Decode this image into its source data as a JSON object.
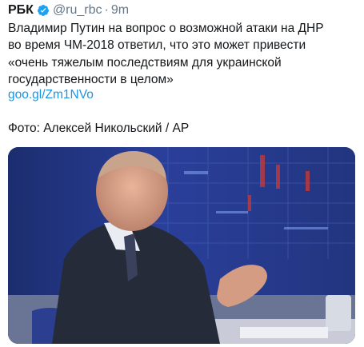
{
  "tweet": {
    "author_name": "РБК",
    "handle": "@ru_rbc",
    "separator": "·",
    "timestamp": "9m",
    "text_lines": [
      "Владимир Путин на вопрос о возможной атаки на ДНР",
      "во время ЧМ-2018 ответил, что это может привести",
      "«очень тяжелым последствиям для украинской",
      "государственности в целом»"
    ],
    "link": "goo.gl/Zm1NVo",
    "photo_credit": "Фото: Алексей Никольский / AP"
  },
  "icons": {
    "verified": "verified-badge-icon"
  },
  "colors": {
    "link": "#1b95e0",
    "secondary_text": "#657786",
    "verified": "#1da1f2"
  }
}
